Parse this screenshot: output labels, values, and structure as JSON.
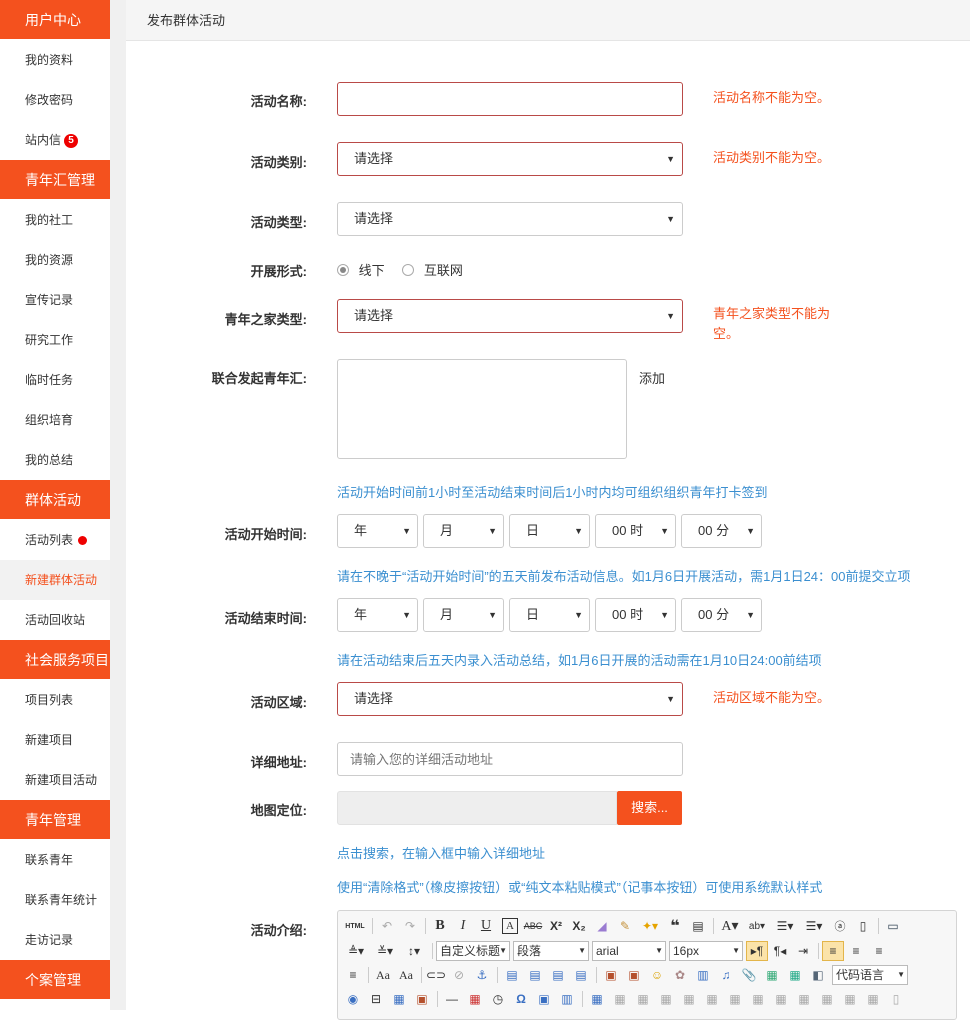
{
  "sidebar": {
    "sections": [
      {
        "title": "用户中心",
        "items": [
          {
            "label": "我的资料"
          },
          {
            "label": "修改密码"
          },
          {
            "label": "站内信",
            "badge": "5"
          }
        ]
      },
      {
        "title": "青年汇管理",
        "items": [
          {
            "label": "我的社工"
          },
          {
            "label": "我的资源"
          },
          {
            "label": "宣传记录"
          },
          {
            "label": "研究工作"
          },
          {
            "label": "临时任务"
          },
          {
            "label": "组织培育"
          },
          {
            "label": "我的总结"
          }
        ]
      },
      {
        "title": "群体活动",
        "items": [
          {
            "label": "活动列表",
            "dot": true
          },
          {
            "label": "新建群体活动",
            "active": true
          },
          {
            "label": "活动回收站"
          }
        ]
      },
      {
        "title": "社会服务项目",
        "items": [
          {
            "label": "项目列表"
          },
          {
            "label": "新建项目"
          },
          {
            "label": "新建项目活动"
          }
        ]
      },
      {
        "title": "青年管理",
        "items": [
          {
            "label": "联系青年"
          },
          {
            "label": "联系青年统计"
          },
          {
            "label": "走访记录"
          }
        ]
      },
      {
        "title": "个案管理",
        "items": []
      }
    ]
  },
  "header": {
    "title": "发布群体活动"
  },
  "form": {
    "activity_name": {
      "label": "活动名称:",
      "value": "",
      "error": "活动名称不能为空。"
    },
    "activity_category": {
      "label": "活动类别:",
      "value": "请选择",
      "error": "活动类别不能为空。"
    },
    "activity_type": {
      "label": "活动类型:",
      "value": "请选择"
    },
    "format": {
      "label": "开展形式:",
      "options": [
        "线下",
        "互联网"
      ],
      "selected": "线下"
    },
    "youth_home_type": {
      "label": "青年之家类型:",
      "value": "请选择",
      "error": "青年之家类型不能为空。"
    },
    "co_sponsor": {
      "label": "联合发起青年汇:",
      "add_link": "添加"
    },
    "checkin_hint": "活动开始时间前1小时至活动结束时间后1小时内均可组织组织青年打卡签到",
    "start_time": {
      "label": "活动开始时间:",
      "year": "年",
      "month": "月",
      "day": "日",
      "hour": "00 时",
      "minute": "00 分"
    },
    "start_hint": "请在不晚于“活动开始时间”的五天前发布活动信息。如1月6日开展活动，需1月1日24：00前提交立项",
    "end_time": {
      "label": "活动结束时间:",
      "year": "年",
      "month": "月",
      "day": "日",
      "hour": "00 时",
      "minute": "00 分"
    },
    "end_hint": "请在活动结束后五天内录入活动总结，如1月6日开展的活动需在1月10日24:00前结项",
    "region": {
      "label": "活动区域:",
      "value": "请选择",
      "error": "活动区域不能为空。"
    },
    "address": {
      "label": "详细地址:",
      "placeholder": "请输入您的详细活动地址"
    },
    "map": {
      "label": "地图定位:",
      "button": "搜索...",
      "hint": "点击搜索，在输入框中输入详细地址"
    },
    "format_hint": "使用“清除格式”（橡皮擦按钮）或“纯文本粘贴模式”（记事本按钮）可使用系统默认样式",
    "intro": {
      "label": "活动介绍:"
    }
  },
  "editor": {
    "paragraph_format": "自定义标题",
    "paragraph": "段落",
    "font_family": "arial",
    "font_size": "16px",
    "code_language": "代码语言",
    "source_label": "HTML"
  },
  "colors": {
    "accent": "#f4511e",
    "error_border": "#b94a48",
    "hint_blue": "#3b8fd0"
  }
}
